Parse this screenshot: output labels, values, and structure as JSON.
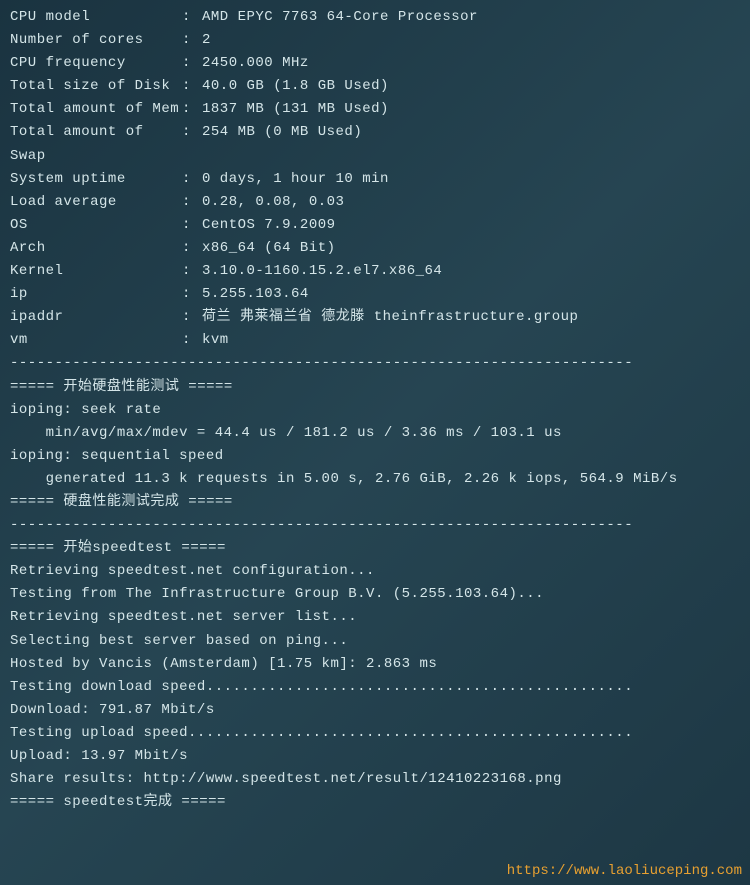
{
  "sysinfo": {
    "cpu_model": {
      "label": "CPU model",
      "value": "AMD EPYC 7763 64-Core Processor"
    },
    "num_cores": {
      "label": "Number of cores",
      "value": "2"
    },
    "cpu_freq": {
      "label": "CPU frequency",
      "value": "2450.000 MHz"
    },
    "disk": {
      "label": "Total size of Disk",
      "value": "40.0 GB (1.8 GB Used)"
    },
    "mem": {
      "label": "Total amount of Mem",
      "value": "1837 MB (131 MB Used)"
    },
    "swap": {
      "label": "Total amount of Swap",
      "value": "254 MB (0 MB Used)"
    },
    "uptime": {
      "label": "System uptime",
      "value": "0 days, 1 hour 10 min"
    },
    "load": {
      "label": "Load average",
      "value": "0.28, 0.08, 0.03"
    },
    "os": {
      "label": "OS",
      "value": "CentOS 7.9.2009"
    },
    "arch": {
      "label": "Arch",
      "value": "x86_64 (64 Bit)"
    },
    "kernel": {
      "label": "Kernel",
      "value": "3.10.0-1160.15.2.el7.x86_64"
    },
    "ip": {
      "label": "ip",
      "value": "5.255.103.64"
    },
    "ipaddr": {
      "label": "ipaddr",
      "value": "荷兰 弗莱福兰省 德龙滕  theinfrastructure.group"
    },
    "vm": {
      "label": "vm",
      "value": " kvm"
    }
  },
  "dashes": "----------------------------------------------------------------------",
  "disk_test": {
    "header": "===== 开始硬盘性能测试 =====",
    "seek_label": "ioping: seek rate",
    "seek_line": "    min/avg/max/mdev = 44.4 us / 181.2 us / 3.36 ms / 103.1 us",
    "seq_label": "ioping: sequential speed",
    "seq_line": "    generated 11.3 k requests in 5.00 s, 2.76 GiB, 2.26 k iops, 564.9 MiB/s",
    "footer": "===== 硬盘性能测试完成 ====="
  },
  "speedtest": {
    "header": "===== 开始speedtest =====",
    "retrieving_config": "Retrieving speedtest.net configuration...",
    "testing_from": "Testing from The Infrastructure Group B.V. (5.255.103.64)...",
    "retrieving_servers": "Retrieving speedtest.net server list...",
    "selecting": "Selecting best server based on ping...",
    "hosted_by": "Hosted by Vancis (Amsterdam) [1.75 km]: 2.863 ms",
    "testing_download": "Testing download speed................................................",
    "download": "Download: 791.87 Mbit/s",
    "testing_upload": "Testing upload speed..................................................",
    "upload": "Upload: 13.97 Mbit/s",
    "share": "Share results: http://www.speedtest.net/result/12410223168.png",
    "footer": "===== speedtest完成 ====="
  },
  "watermark": "https://www.laoliuceping.com"
}
